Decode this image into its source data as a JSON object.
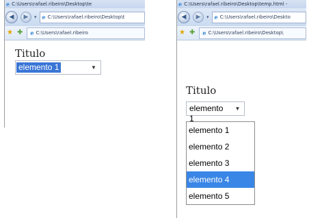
{
  "left": {
    "window_title": "C:\\Users\\rafael.ribeiro\\Desktop\\te",
    "address": "C:\\Users\\rafael.ribeiro\\Desktop\\t",
    "tab_label": "C:\\Users\\rafael.ribeiro",
    "heading": "Titulo",
    "select_value": "elemento 1"
  },
  "right": {
    "window_title": "C:\\Users\\rafael.ribeiro\\Desktop\\temp.html -",
    "address": "C:\\Users\\rafael.ribeiro\\Deskto",
    "tab_label": "C:\\Users\\rafael.ribeiro\\Desktop\\",
    "heading": "Titulo",
    "select_value": "elemento 1",
    "options": [
      "elemento 1",
      "elemento 2",
      "elemento 3",
      "elemento 4",
      "elemento 5"
    ],
    "highlighted_option": "elemento 4"
  },
  "colors": {
    "selection": "#3a86e6",
    "toolbar": "#c9daf0"
  },
  "icons": {
    "back": "back-arrow-icon",
    "forward": "forward-arrow-icon",
    "favorites": "star-icon",
    "add_favorite": "add-favorite-icon",
    "page": "ie-page-icon"
  }
}
